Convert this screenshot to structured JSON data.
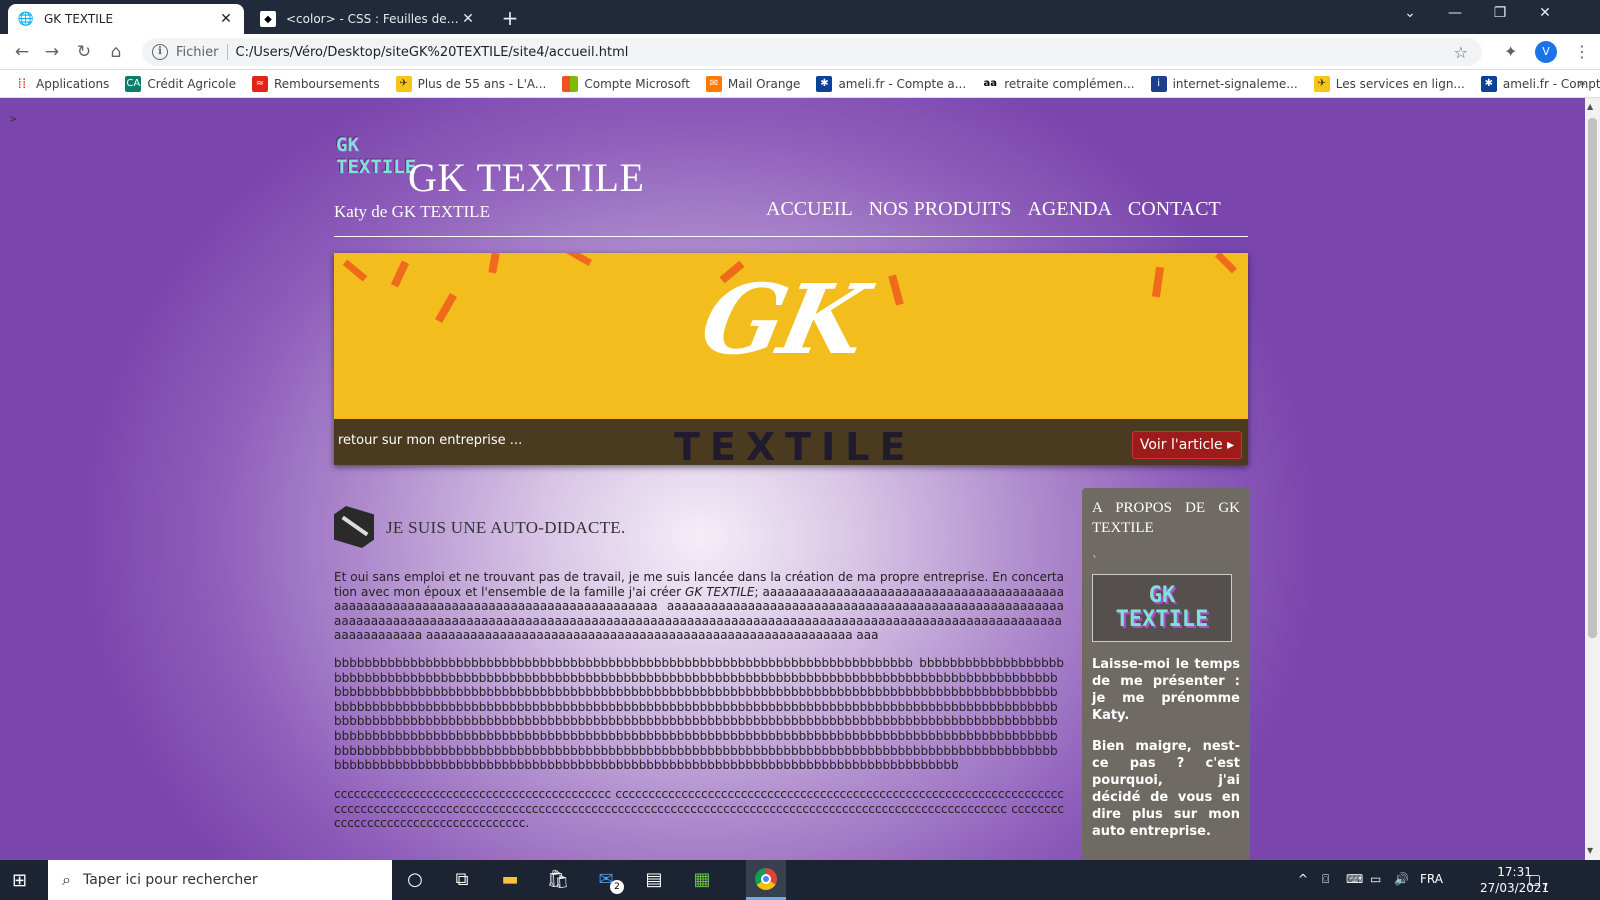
{
  "browser": {
    "tabs": [
      {
        "title": "GK TEXTILE",
        "active": true
      },
      {
        "title": "<color> - CSS : Feuilles de style en cascade",
        "active": false
      }
    ],
    "new_tab": "+",
    "window_controls": {
      "minimize": "—",
      "restore": "❐",
      "close": "✕"
    },
    "address": {
      "scheme_label": "Fichier",
      "url": "C:/Users/Véro/Desktop/siteGK%20TEXTILE/site4/accueil.html"
    },
    "avatar_letter": "V",
    "bookmarks": [
      {
        "label": "Applications",
        "icon": "apps-grid-icon"
      },
      {
        "label": "Crédit Agricole",
        "icon": "credit-agricole-icon"
      },
      {
        "label": "Remboursements",
        "icon": "remboursements-icon"
      },
      {
        "label": "Plus de 55 ans - L'A...",
        "icon": "plus55-icon"
      },
      {
        "label": "Compte Microsoft",
        "icon": "microsoft-icon"
      },
      {
        "label": "Mail Orange",
        "icon": "mail-orange-icon"
      },
      {
        "label": "ameli.fr - Compte a...",
        "icon": "ameli-icon"
      },
      {
        "label": "retraite complémen...",
        "icon": "retraite-icon"
      },
      {
        "label": "internet-signaleme...",
        "icon": "internet-signalement-icon"
      },
      {
        "label": "Les services en lign...",
        "icon": "services-icon"
      },
      {
        "label": "ameli.fr - Compte a...",
        "icon": "ameli-icon"
      }
    ],
    "bookmarks_overflow": "»"
  },
  "page": {
    "corner_mark": ">",
    "logo_small": "GK\nTEXTILE",
    "site_title": "GK TEXTILE",
    "site_subtitle": "Katy de GK TEXTILE",
    "nav": [
      "ACCUEIL",
      "NOS PRODUITS",
      "AGENDA",
      "CONTACT"
    ],
    "banner": {
      "logo_text": "GK",
      "logo_sub": "TEXTILE",
      "caption": "retour sur mon entreprise ...",
      "button": "Voir l'article ▸"
    },
    "article": {
      "title": "JE SUIS UNE AUTO-DIDACTE.",
      "p1_before": "Et oui sans emploi et ne trouvant pas de travail, je me suis lancée dans la création de ma propre entreprise. En concertation avec mon époux et l'ensemble de la famille j'ai créer ",
      "p1_em": "GK TEXTILE",
      "p1_after": "; aaaaaaaaaaaaaaaaaaaaaaaaaaaaaaaaaaaaaaaaaaaaaaaaaaaaaaaaaaaaaaaaaaaaaaaaaaaaaaaaaaaaa aaaaaaaaaaaaaaaaaaaaaaaaaaaaaaaaaaaaaaaaaaaaaaaaaaaaaaaaaaaaaaaaaaaaaaaaaaaaaaaaaaaaaaaaaaaaaaaaaaaaaaaaaaaaaaaaaaaaaaaaaaaaaaaaaaaaaaaaaaaaaaaaaaaaaaaaaaaaaaaaaaaaa aaaaaaaaaaaaaaaaaaaaaaaaaaaaaaaaaaaaaaaaaaaaaaaaaaaaaaaaaa aaa",
      "p2": "bbbbbbbbbbbbbbbbbbbbbbbbbbbbbbbbbbbbbbbbbbbbbbbbbbbbbbbbbbbbbbbbbbbbbbbbbbbb bbbbbbbbbbbbbbbbbbbbbbbbbbbbbbbbbbbbbbbbbbbbbbbbbbbbbbbbbbbbbbbbbbbbbbbbbbbbbbbbbbbbbbbbbbbbbbbbbbbbbbbbbbbbbbbbbbbbbbbbbbbbbbbbbbbbbbbbbbbbbbbbbbbbbbbbbbbbbbbbbbbbbbbbbbbbbbbbbbbbbbbbbbbbbbbbbbbbbbbbbbbbbbbbbbbbbbbbbbbbbbbbbbbbbbbbbbbbbbbbbbbbbbbbbbbbbbbbbbbbbbbbbbbbbbbbbbbbbbbbbbbbbbbbbbbbbbbbbbbbbbbbbbbbbbbbbbbbbbbbbbbbbbbbbbbbbbbbbbbbbbbbbbbbbbbbbbbbbbbbbbbbbbbbbbbbbbbbbbbbbbbbbbbbbbbbbbbbbbbbbbbbbbbbbbbbbbbbbbbbbbbbbbbbbbbbbbbbbbbbbbbbbbbbbbbbbbbbbbbbbbbbbbbbbbbbbbbbbbbbbbbbbbbbbbbbbbbbbbbbbbbbbbbbbbbbbbbbbbbbbbbbbbbbbbbbbbbbbbbbbbbbbbbbbbbbbbbbbbbbbbbbbbbbbbbbbbbbbbbbbbbbbbbbbbbbbbbbbbbbbbbbbbbbbbbbbbbbbbbbbbbbbbbbbbbbbbbbbbbbbbbbbbbbbbbbbbbbbbbbbbbbbbbbbbb",
      "p3": "cccccccccccccccccccccccccccccccccccccccccc cccccccccccccccccccccccccccccccccccccccccccccccccccccccccccccccccccccccccccccccccccccccccccccccccccccccccccccccccccccccccccccccccccccccccccccccccccccccccccccccccccccccccc ccccccccccccccccccccccccccccccccccccc."
    },
    "sidebar": {
      "title": "A PROPOS DE GK TEXTILE",
      "tick": "`",
      "logo": "GK\nTEXTILE",
      "p1": "Laisse-moi le temps de me présenter : je me prénomme Katy.",
      "p2": "Bien maigre, nest-ce pas ? c'est pourquoi, j'ai décidé de vous en dire plus sur mon auto entreprise."
    }
  },
  "taskbar": {
    "search_placeholder": "Taper ici pour rechercher",
    "mail_badge": "2",
    "language": "FRA",
    "time": "17:31",
    "date": "27/03/2021",
    "notification_count": "7"
  }
}
